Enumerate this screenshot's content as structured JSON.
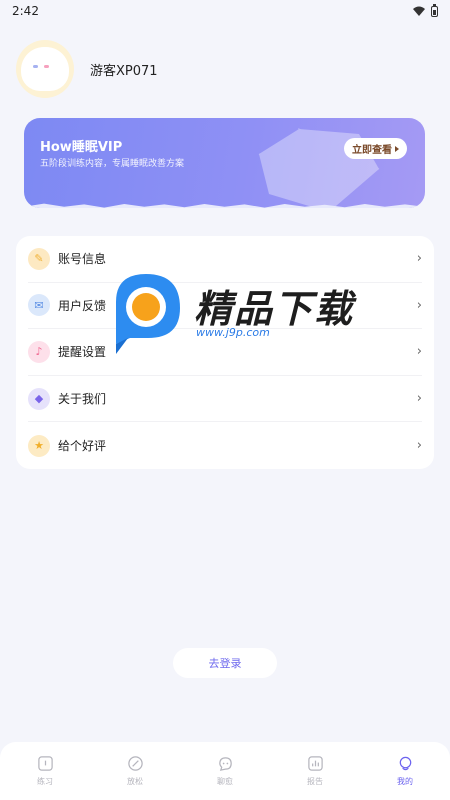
{
  "status_bar": {
    "time": "2:42"
  },
  "profile": {
    "username": "游客XP071"
  },
  "vip": {
    "title": "How睡眠VIP",
    "subtitle": "五阶段训练内容，专属睡眠改善方案",
    "button_label": "立即查看"
  },
  "menu": {
    "items": [
      {
        "label": "账号信息",
        "icon": "pencil-icon"
      },
      {
        "label": "用户反馈",
        "icon": "mail-icon"
      },
      {
        "label": "提醒设置",
        "icon": "bell-icon"
      },
      {
        "label": "关于我们",
        "icon": "diamond-icon"
      },
      {
        "label": "给个好评",
        "icon": "star-icon"
      }
    ]
  },
  "watermark": {
    "text": "精品下载",
    "url": "www.j9p.com"
  },
  "logout": {
    "label": "去登录"
  },
  "tabs": [
    {
      "label": "练习",
      "icon": "home-icon",
      "active": false
    },
    {
      "label": "放松",
      "icon": "compass-icon",
      "active": false
    },
    {
      "label": "聊愈",
      "icon": "chat-icon",
      "active": false
    },
    {
      "label": "报告",
      "icon": "chart-icon",
      "active": false
    },
    {
      "label": "我的",
      "icon": "profile-icon",
      "active": true
    }
  ],
  "colors": {
    "accent": "#6c63ef",
    "vip_gradient_start": "#7d89f3",
    "vip_gradient_end": "#a59af4"
  }
}
